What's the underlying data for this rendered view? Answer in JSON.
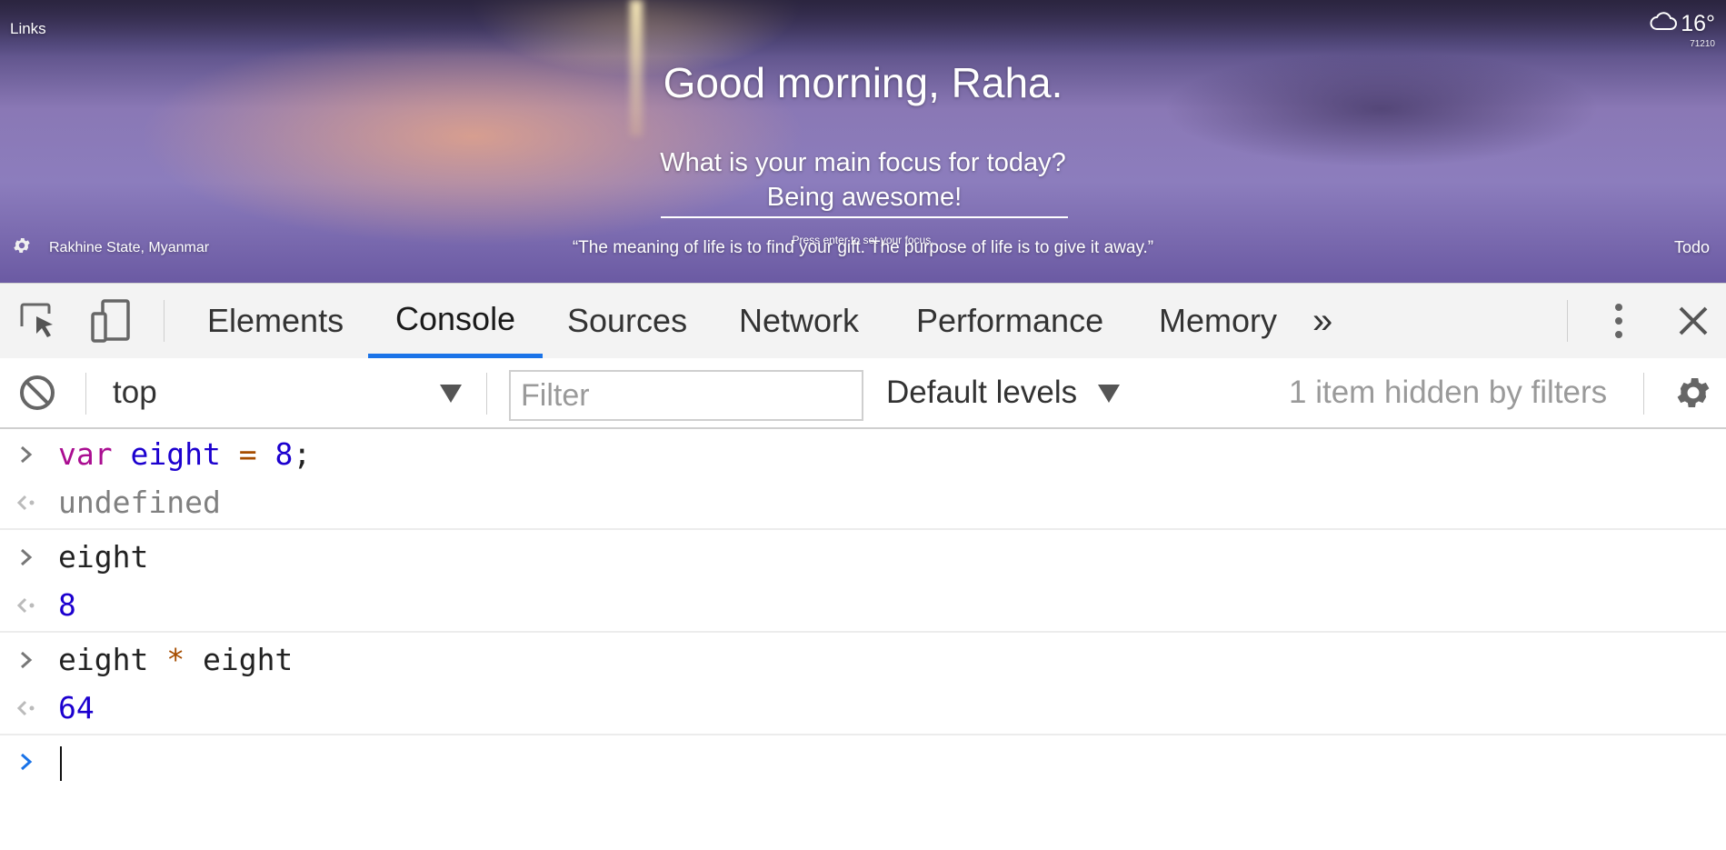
{
  "page": {
    "links_label": "Links",
    "weather": {
      "temperature": "16°",
      "location_code": "71210",
      "icon": "cloud-icon"
    },
    "greeting": "Good morning, Raha.",
    "focus_question": "What is your main focus for today?",
    "focus_value": "Being awesome!",
    "focus_hint": "Press enter to set your focus.",
    "quote": "“The meaning of life is to find your gift. The purpose of life is to give it away.”",
    "location": "Rakhine State, Myanmar",
    "todo_label": "Todo"
  },
  "devtools": {
    "tabs": [
      {
        "label": "Elements",
        "active": false
      },
      {
        "label": "Console",
        "active": true
      },
      {
        "label": "Sources",
        "active": false
      },
      {
        "label": "Network",
        "active": false
      },
      {
        "label": "Performance",
        "active": false
      },
      {
        "label": "Memory",
        "active": false
      }
    ],
    "more_tabs_icon": "»",
    "toolbar": {
      "context": "top",
      "filter_placeholder": "Filter",
      "levels": "Default levels",
      "hidden_status": "1 item hidden by filters"
    },
    "console": {
      "entries": [
        {
          "input": "var eight = 8;",
          "output": "undefined"
        },
        {
          "input": "eight",
          "output": "8"
        },
        {
          "input": "eight * eight",
          "output": "64"
        }
      ],
      "prompt_value": ""
    },
    "colors": {
      "accent": "#1a73e8",
      "keyword": "#aa0d91",
      "number": "#1c00cf",
      "operator": "#a64d00"
    }
  }
}
